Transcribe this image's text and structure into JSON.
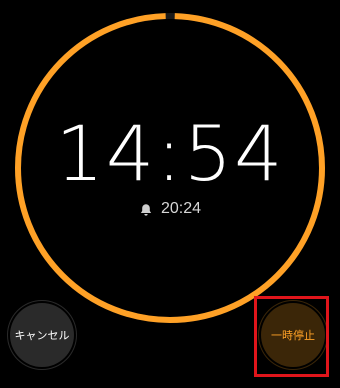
{
  "timer": {
    "remaining": "14:54",
    "end_time": "20:24",
    "progress": 0.99
  },
  "buttons": {
    "cancel_label": "キャンセル",
    "pause_label": "一時停止"
  },
  "icons": {
    "alarm": "bell-icon"
  },
  "colors": {
    "accent": "#FFA126",
    "background": "#000000",
    "highlight": "#E0151B"
  }
}
